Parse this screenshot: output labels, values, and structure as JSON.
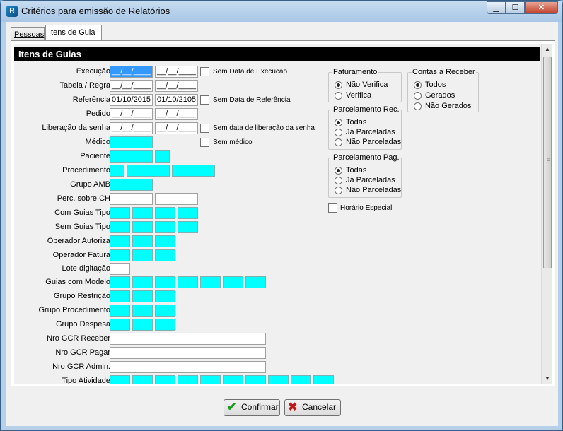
{
  "window": {
    "title": "Critérios para emissão de Relatórios",
    "controls": {
      "minimize": "▁",
      "maximize": "☐",
      "close": "✕"
    }
  },
  "tabs": [
    {
      "label": "Pessoas",
      "active": false
    },
    {
      "label": "Itens de Guia",
      "active": true
    }
  ],
  "section": {
    "header": "Itens de Guias"
  },
  "fields": {
    "execucao": {
      "label": "Execução",
      "from": "__/__/____",
      "to": "__/__/____",
      "checkbox": "Sem Data de Execucao"
    },
    "tabela_regra": {
      "label": "Tabela / Regra",
      "from": "__/__/____",
      "to": "__/__/____"
    },
    "referencia": {
      "label": "Referência",
      "from": "01/10/2015",
      "to": "01/10/2105",
      "checkbox": "Sem Data de Referência"
    },
    "pedido": {
      "label": "Pedido",
      "from": "__/__/____",
      "to": "__/__/____"
    },
    "liberacao": {
      "label": "Liberação da senha",
      "from": "__/__/____",
      "to": "__/__/____",
      "checkbox": "Sem data de liberação da senha"
    },
    "medico": {
      "label": "Médico",
      "checkbox": "Sem médico"
    },
    "paciente": {
      "label": "Paciente"
    },
    "procedimento": {
      "label": "Procedimento"
    },
    "grupo_amb": {
      "label": "Grupo AMB"
    },
    "perc_ch": {
      "label": "Perc. sobre CH"
    },
    "com_guias_tipo": {
      "label": "Com Guias Tipo"
    },
    "sem_guias_tipo": {
      "label": "Sem Guias Tipo"
    },
    "operador_autoriza": {
      "label": "Operador Autoriza"
    },
    "operador_fatura": {
      "label": "Operador Fatura"
    },
    "lote_digitacao": {
      "label": "Lote digitação"
    },
    "guias_com_modelo": {
      "label": "Guias com Modelo"
    },
    "grupo_restricao": {
      "label": "Grupo Restrição"
    },
    "grupo_procedimento": {
      "label": "Grupo Procedimento"
    },
    "grupo_despesa": {
      "label": "Grupo Despesa"
    },
    "nro_gcr_receber": {
      "label": "Nro GCR Receber"
    },
    "nro_gcr_pagar": {
      "label": "Nro GCR Pagar"
    },
    "nro_gcr_admin": {
      "label": "Nro GCR Admin."
    },
    "tipo_atividade": {
      "label": "Tipo Atividade"
    }
  },
  "groups": {
    "faturamento": {
      "title": "Faturamento",
      "options": [
        "Não Verifica",
        "Verifica"
      ],
      "selected": 0
    },
    "contas_receber": {
      "title": "Contas a Receber",
      "options": [
        "Todos",
        "Gerados",
        "Não Gerados"
      ],
      "selected": 0
    },
    "parcelamento_rec": {
      "title": "Parcelamento Rec.",
      "options": [
        "Todas",
        "Já Parceladas",
        "Não Parceladas"
      ],
      "selected": 0
    },
    "parcelamento_pag": {
      "title": "Parcelamento Pag.",
      "options": [
        "Todas",
        "Já Parceladas",
        "Não Parceladas"
      ],
      "selected": 0
    }
  },
  "horario_especial": {
    "label": "Horário Especial",
    "checked": false
  },
  "buttons": {
    "confirmar": {
      "label_prefix": "",
      "accel": "C",
      "label_rest": "onfirmar",
      "icon": "✔",
      "icon_color": "#1a9a1a"
    },
    "cancelar": {
      "label_prefix": "",
      "accel": "C",
      "label_rest": "ancelar",
      "icon": "✖",
      "icon_color": "#c01818"
    }
  },
  "colors": {
    "lookup_field": "#00ffff",
    "header_bg": "#000000",
    "selection": "#3399ff"
  }
}
